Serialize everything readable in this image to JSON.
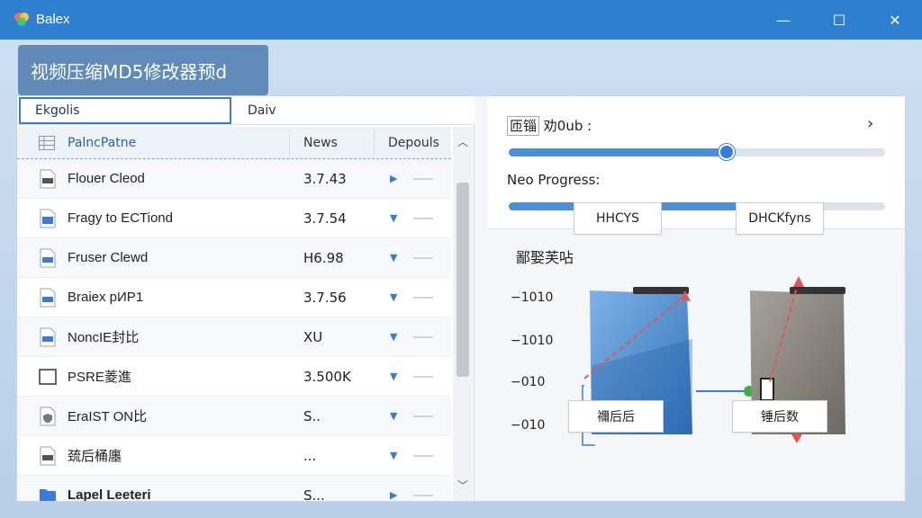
{
  "window": {
    "title": "Balex",
    "minimize": "—",
    "maximize": "☐",
    "close": "✕"
  },
  "banner": {
    "text": "视频压缩MD5修改器预d"
  },
  "tabs": [
    {
      "label": "Ekgolis"
    },
    {
      "label": "Daiv"
    }
  ],
  "table": {
    "headers": [
      "PalncPatne",
      "News",
      "Depouls"
    ],
    "rows": [
      {
        "name": "Flouer Cleod",
        "value": "3.7.43",
        "icon": "file-icon"
      },
      {
        "name": "Fragy to ECTiond",
        "value": "3.7.54",
        "icon": "image-file-icon"
      },
      {
        "name": "Fruser Clewd",
        "value": "H6.98",
        "icon": "document-icon"
      },
      {
        "name": "Braiex рИР1",
        "value": "3.7.56",
        "icon": "document-icon"
      },
      {
        "name": "NoncIE封比",
        "value": "XU",
        "icon": "document-icon"
      },
      {
        "name": "PSRE菱進",
        "value": "3.500K",
        "icon": "frame-icon"
      },
      {
        "name": "EraIST ON比",
        "value": "S..",
        "icon": "shield-file-icon"
      },
      {
        "name": "巯后桶廛",
        "value": "...",
        "icon": "file-icon"
      },
      {
        "name": "Lapel Leeteri",
        "value": "S...",
        "icon": "folder-icon"
      }
    ]
  },
  "output": {
    "label_boxed": "匝锱",
    "label_rest": " 劝0ub :",
    "slider_value": 0.58
  },
  "progress": {
    "label": "Neo Progress:",
    "value": 0.77
  },
  "diagram": {
    "title": "鄙娶芙呫",
    "left_top_label": "HHCYS",
    "right_top_label": "DHCKfyns",
    "left_bottom_label": "禰后后",
    "right_bottom_label": "锤后数",
    "yticks": [
      "−1010",
      "−1010",
      "−010",
      "−010"
    ]
  },
  "colors": {
    "titlebar": "#2f7fd0",
    "accent": "#3a7bd5",
    "arrow_red": "#e05555",
    "node_green": "#3cb043"
  }
}
